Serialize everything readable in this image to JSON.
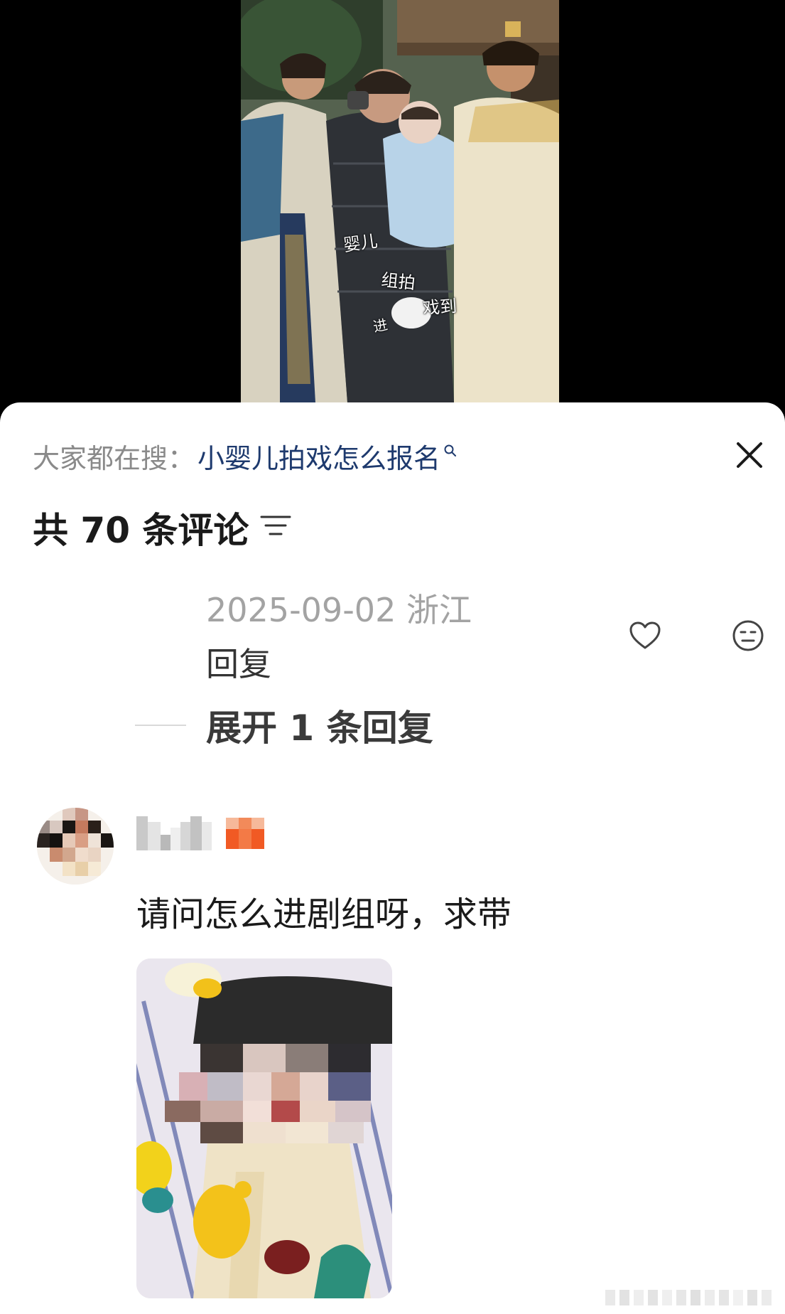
{
  "video": {
    "caption_words": [
      "婴儿",
      "组拍",
      "戏到",
      "进"
    ]
  },
  "search_bar": {
    "prefix": "大家都在搜：",
    "term": "小婴儿拍戏怎么报名",
    "search_icon": "search-icon"
  },
  "comments_header": {
    "count_label": "共 70 条评论",
    "sort_icon": "sort-filter-icon",
    "close_icon": "close-icon"
  },
  "previous_comment": {
    "date_location": "2025-09-02 浙江",
    "reply_label": "回复",
    "like_icon": "heart-icon",
    "dislike_icon": "neutral-face-icon",
    "expand_label": "展开 1 条回复"
  },
  "comment": {
    "avatar_icon": "avatar-pixelated",
    "badge_icon": "fan-level-badge",
    "text": "请问怎么进剧组呀，求带"
  },
  "colors": {
    "search_term": "#1e3a6e",
    "muted_text": "#8a8a8a",
    "badge_orange": "#f15a24"
  }
}
